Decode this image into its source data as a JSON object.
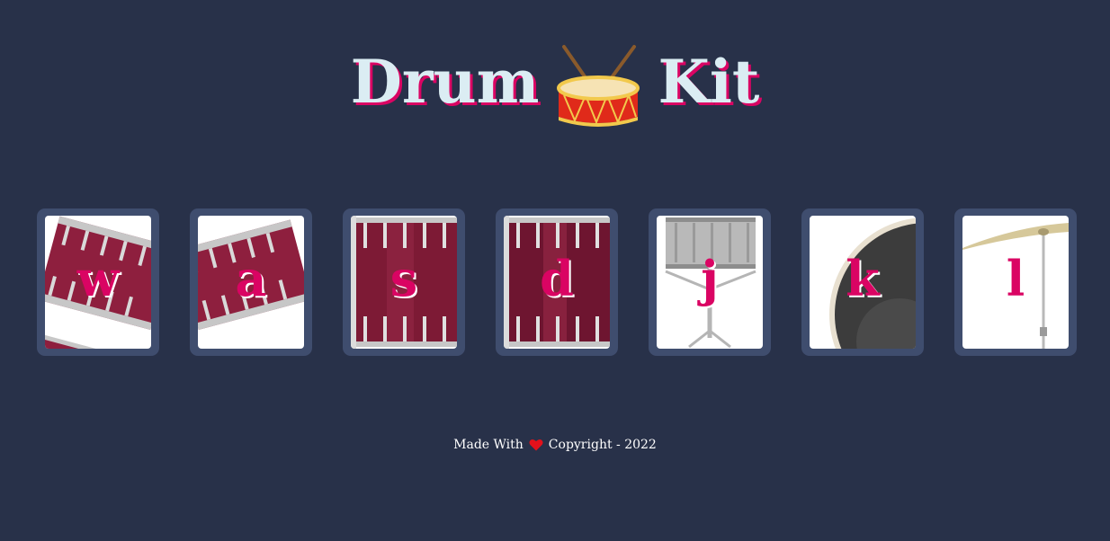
{
  "header": {
    "title_left": "Drum",
    "title_icon": "drum-icon",
    "title_right": "Kit"
  },
  "drums": [
    {
      "key": "w",
      "image": "tom-1"
    },
    {
      "key": "a",
      "image": "tom-2"
    },
    {
      "key": "s",
      "image": "tom-3"
    },
    {
      "key": "d",
      "image": "tom-4"
    },
    {
      "key": "j",
      "image": "snare"
    },
    {
      "key": "k",
      "image": "kick"
    },
    {
      "key": "l",
      "image": "crash"
    }
  ],
  "footer": {
    "made_with": "Made With",
    "heart_icon": "heart-icon",
    "copyright": "Copyright - 2022"
  },
  "colors": {
    "background": "#283149",
    "title_text": "#DBEDF3",
    "accent": "#DA0463",
    "button_frame": "#3f4d6e"
  }
}
